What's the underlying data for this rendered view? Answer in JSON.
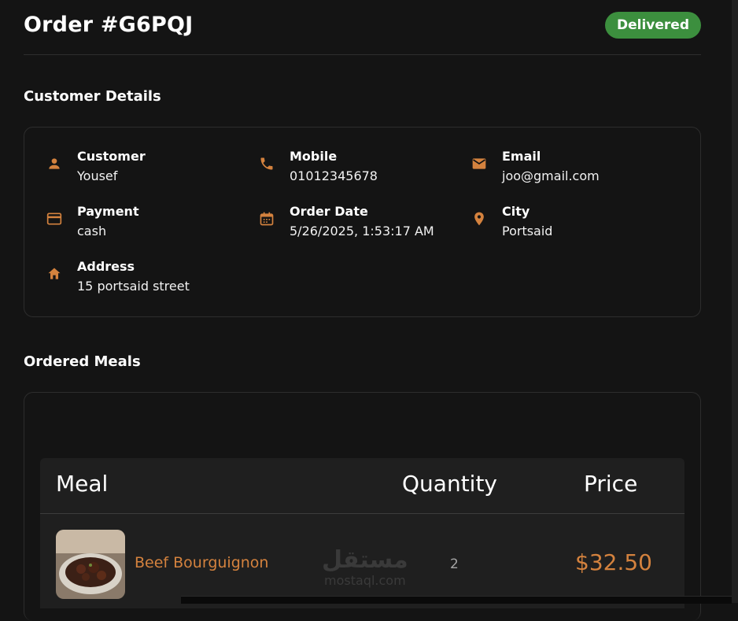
{
  "order": {
    "title": "Order #G6PQJ",
    "status": "Delivered",
    "status_color": "#3c8f3e"
  },
  "customer_section": {
    "title": "Customer Details",
    "fields": {
      "customer": {
        "label": "Customer",
        "value": "Yousef",
        "icon": "person-icon"
      },
      "mobile": {
        "label": "Mobile",
        "value": "01012345678",
        "icon": "phone-icon"
      },
      "email": {
        "label": "Email",
        "value": "joo@gmail.com",
        "icon": "mail-icon"
      },
      "payment": {
        "label": "Payment",
        "value": "cash",
        "icon": "credit-card-icon"
      },
      "order_date": {
        "label": "Order Date",
        "value": "5/26/2025, 1:53:17 AM",
        "icon": "calendar-icon"
      },
      "city": {
        "label": "City",
        "value": "Portsaid",
        "icon": "location-pin-icon"
      },
      "address": {
        "label": "Address",
        "value": "15 portsaid street",
        "icon": "home-icon"
      }
    }
  },
  "meals_section": {
    "title": "Ordered Meals",
    "columns": {
      "meal": "Meal",
      "quantity": "Quantity",
      "price": "Price"
    },
    "rows": [
      {
        "name": "Beef Bourguignon",
        "quantity": "2",
        "price": "$32.50"
      }
    ]
  },
  "watermark": {
    "arabic": "مستقل",
    "latin": "mostaql.com"
  },
  "colors": {
    "accent": "#d4823e",
    "background": "#141414",
    "table_bg": "#1f1f1f"
  }
}
